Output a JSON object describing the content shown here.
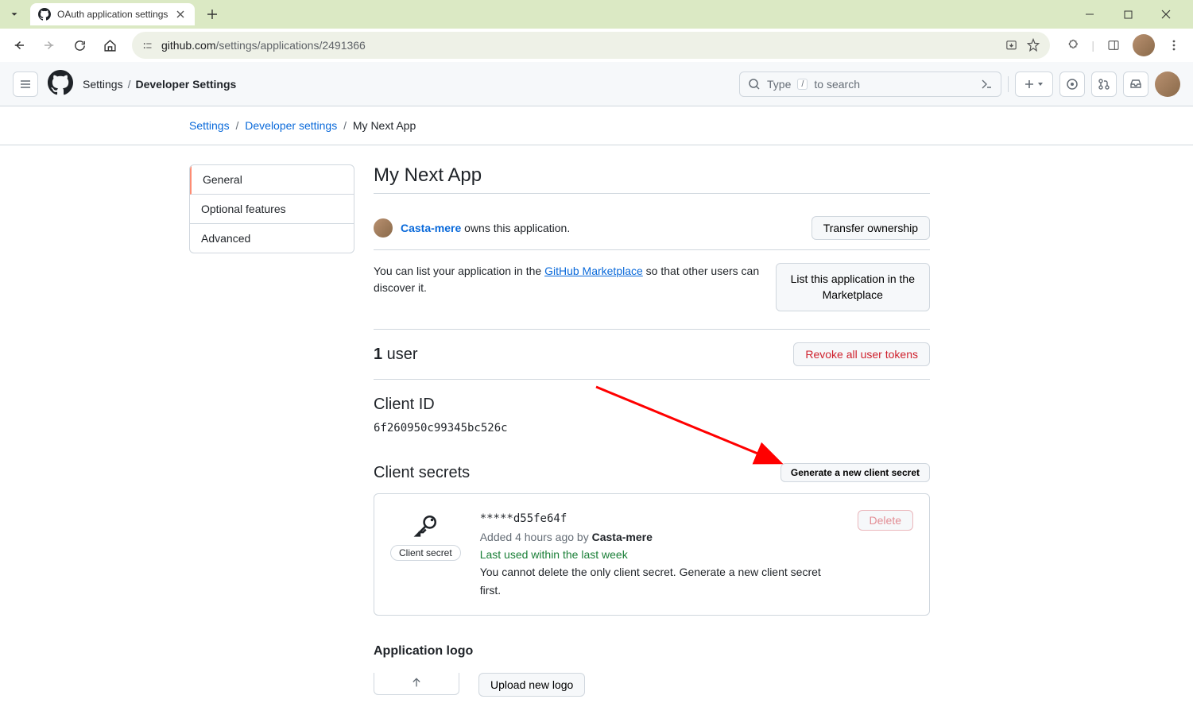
{
  "browser": {
    "tab_title": "OAuth application settings",
    "url_domain": "github.com",
    "url_path": "/settings/applications/2491366"
  },
  "gh_header": {
    "crumb1": "Settings",
    "crumb2": "Developer Settings",
    "search_prefix": "Type",
    "search_kbd": "/",
    "search_suffix": "to search"
  },
  "page_crumb": {
    "settings": "Settings",
    "dev": "Developer settings",
    "app": "My Next App"
  },
  "sidebar": {
    "items": [
      {
        "label": "General"
      },
      {
        "label": "Optional features"
      },
      {
        "label": "Advanced"
      }
    ]
  },
  "main": {
    "title": "My Next App",
    "owner_name": "Casta-mere",
    "owner_text": " owns this application.",
    "transfer_btn": "Transfer ownership",
    "marketplace_pre": "You can list your application in the ",
    "marketplace_link": "GitHub Marketplace",
    "marketplace_post": " so that other users can discover it.",
    "list_btn_line1": "List this application in the",
    "list_btn_line2": "Marketplace",
    "user_count": "1",
    "user_label": " user",
    "revoke_btn": "Revoke all user tokens",
    "client_id_label": "Client ID",
    "client_id_value": "6f260950c99345bc526c",
    "secrets_label": "Client secrets",
    "generate_btn": "Generate a new client secret",
    "secret_badge": "Client secret",
    "secret_value": "*****d55fe64f",
    "secret_added_pre": "Added 4 hours ago by ",
    "secret_added_by": "Casta-mere",
    "secret_last_used": "Last used within the last week",
    "secret_note": "You cannot delete the only client secret. Generate a new client secret first.",
    "delete_btn": "Delete",
    "logo_heading": "Application logo",
    "upload_btn": "Upload new logo"
  }
}
